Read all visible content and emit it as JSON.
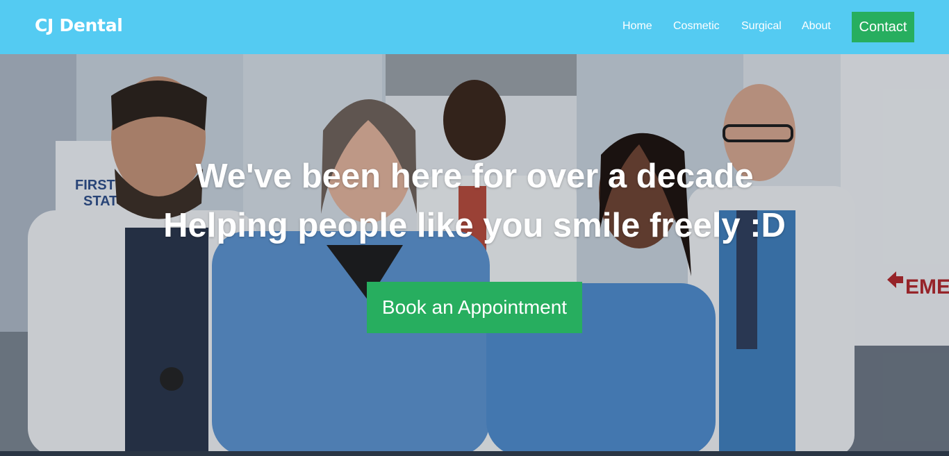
{
  "brand": {
    "name": "CJ Dental"
  },
  "nav": {
    "home": "Home",
    "cosmetic": "Cosmetic",
    "surgical": "Surgical",
    "about": "About",
    "contact": "Contact"
  },
  "hero": {
    "line1": "We've been here for over a decade",
    "line2": "Helping people like you smile freely :D",
    "cta": "Book an Appointment",
    "sign_first": "FIRST",
    "sign_station": "STAT",
    "sign_emergency": "EMERGE"
  },
  "colors": {
    "nav_bg": "#54cbf2",
    "accent_green": "#27ae5f",
    "text": "#ffffff"
  }
}
